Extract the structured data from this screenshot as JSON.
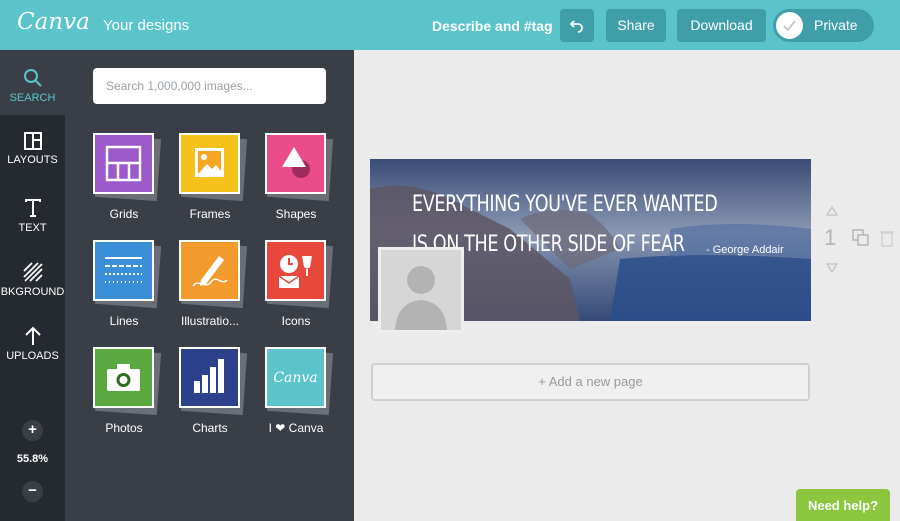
{
  "header": {
    "logo": "Canva",
    "your_designs": "Your designs",
    "describe_tag": "Describe and #tag",
    "share": "Share",
    "download": "Download",
    "private": "Private",
    "accent_color": "#5bc4cb",
    "button_color": "#3f9ea7"
  },
  "rail": {
    "items": [
      {
        "label": "SEARCH",
        "icon": "search-icon",
        "active": true
      },
      {
        "label": "LAYOUTS",
        "icon": "layouts-icon"
      },
      {
        "label": "TEXT",
        "icon": "text-icon"
      },
      {
        "label": "BKGROUND",
        "icon": "background-icon"
      },
      {
        "label": "UPLOADS",
        "icon": "upload-icon"
      }
    ],
    "zoom_in": "+",
    "zoom_level": "55.8%",
    "zoom_out": "−"
  },
  "panel": {
    "search_placeholder": "Search 1,000,000 images...",
    "tiles": [
      {
        "label": "Grids",
        "icon": "grid-icon",
        "color": "#9b59c9"
      },
      {
        "label": "Frames",
        "icon": "frame-icon",
        "color": "#f5c21b"
      },
      {
        "label": "Shapes",
        "icon": "shapes-icon",
        "color": "#ea4c89"
      },
      {
        "label": "Lines",
        "icon": "lines-icon",
        "color": "#3a8fd8"
      },
      {
        "label": "Illustratio...",
        "icon": "pencil-icon",
        "color": "#f29b2c"
      },
      {
        "label": "Icons",
        "icon": "icons-icon",
        "color": "#e8473c"
      },
      {
        "label": "Photos",
        "icon": "camera-icon",
        "color": "#5aa83e"
      },
      {
        "label": "Charts",
        "icon": "chart-icon",
        "color": "#2c3f8a"
      },
      {
        "label": "I ❤ Canva",
        "icon": "canva-icon",
        "color": "#5bc4cb"
      }
    ]
  },
  "design": {
    "quote_line1": "EVERYTHING YOU'VE EVER WANTED",
    "quote_line2": "IS ON THE OTHER SIDE OF FEAR",
    "author": "- George Addair",
    "page_number": "1"
  },
  "add_page": "+ Add a new page",
  "need_help": "Need help?"
}
